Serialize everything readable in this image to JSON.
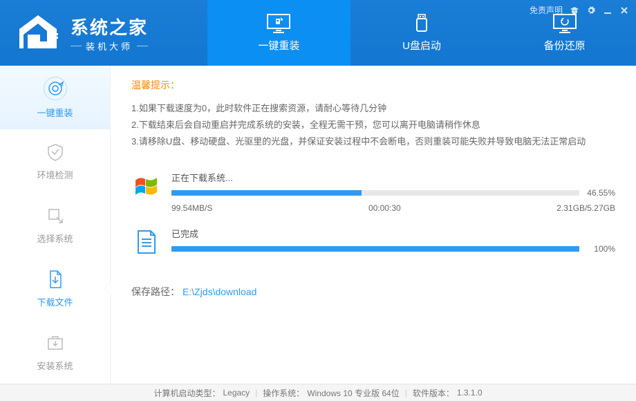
{
  "brand": {
    "title": "系统之家",
    "subtitle": "装机大师"
  },
  "titlebar": {
    "disclaimer": "免责声明"
  },
  "topTabs": [
    {
      "label": "一键重装",
      "active": true
    },
    {
      "label": "U盘启动",
      "active": false
    },
    {
      "label": "备份还原",
      "active": false
    }
  ],
  "sidebar": [
    {
      "label": "一键重装",
      "head": true
    },
    {
      "label": "环境检测"
    },
    {
      "label": "选择系统"
    },
    {
      "label": "下载文件",
      "active": true
    },
    {
      "label": "安装系统"
    }
  ],
  "tips": {
    "title": "温馨提示：",
    "lines": [
      "1.如果下载速度为0，此时软件正在搜索资源，请耐心等待几分钟",
      "2.下载结束后会自动重启并完成系统的安装，全程无需干预，您可以离开电脑请稍作休息",
      "3.请移除U盘、移动硬盘、光驱里的光盘，并保证安装过程中不会断电，否则重装可能失败并导致电脑无法正常启动"
    ]
  },
  "download": {
    "label": "正在下载系统...",
    "percent": 46.55,
    "percentText": "46.55%",
    "speed": "99.54MB/S",
    "eta": "00:00:30",
    "size": "2.31GB/5.27GB"
  },
  "complete": {
    "label": "已完成",
    "percent": 100,
    "percentText": "100%"
  },
  "savePath": {
    "label": "保存路径：",
    "value": "E:\\Zjds\\download"
  },
  "footer": {
    "bootTypeLabel": "计算机启动类型：",
    "bootType": "Legacy",
    "osLabel": "操作系统：",
    "os": "Windows 10 专业版 64位",
    "versionLabel": "软件版本：",
    "version": "1.3.1.0"
  }
}
